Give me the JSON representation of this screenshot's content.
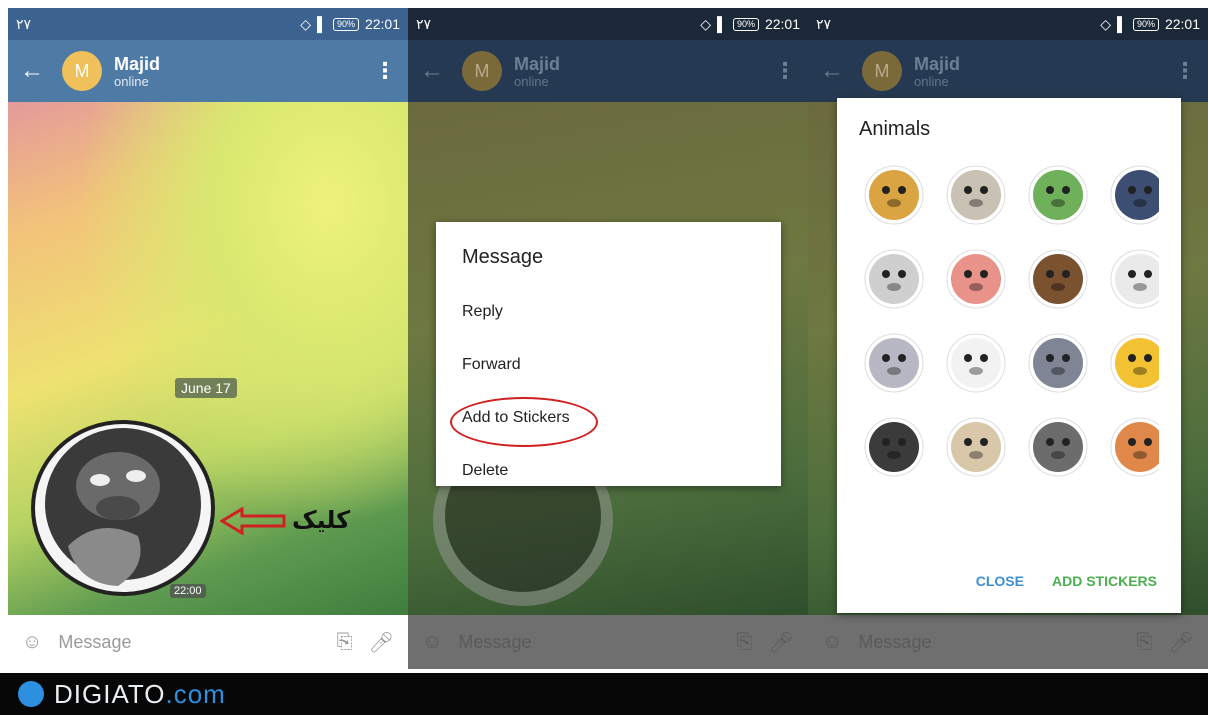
{
  "colors": {
    "header": "#4e7aa6",
    "accent": "#3d8fd0",
    "add": "#4caf50",
    "avatar": "#f0c05a",
    "annotation_red": "#d02020"
  },
  "status_bar": {
    "carrier": "۲۷",
    "battery": "90%",
    "time": "22:01"
  },
  "chat_header": {
    "back_icon": "arrow-left-icon",
    "avatar_letter": "M",
    "name": "Majid",
    "status": "online",
    "menu_icon": "more-vertical-icon"
  },
  "input_bar": {
    "emoji_icon": "smile-icon",
    "placeholder": "Message",
    "attach_icon": "paperclip-icon",
    "mic_icon": "microphone-icon"
  },
  "panel1": {
    "date": "June 17",
    "sticker_time": "22:00",
    "annotation": "کلیک"
  },
  "message_dialog": {
    "title": "Message",
    "items": [
      "Reply",
      "Forward",
      "Add to Stickers",
      "Delete"
    ]
  },
  "sticker_sheet": {
    "title": "Animals",
    "close_label": "CLOSE",
    "add_label": "ADD STICKERS",
    "stickers": [
      "doge",
      "grumpy-cat",
      "frog",
      "pigeon",
      "koala",
      "pig",
      "bear",
      "goat",
      "elephant",
      "panda",
      "rat",
      "chick",
      "gorilla",
      "cat",
      "raccoon",
      "hamster",
      "sticker-17",
      "sticker-18",
      "sticker-19",
      "sticker-20"
    ]
  },
  "watermark": {
    "brand": "DIGIATO",
    "suffix": ".com"
  }
}
